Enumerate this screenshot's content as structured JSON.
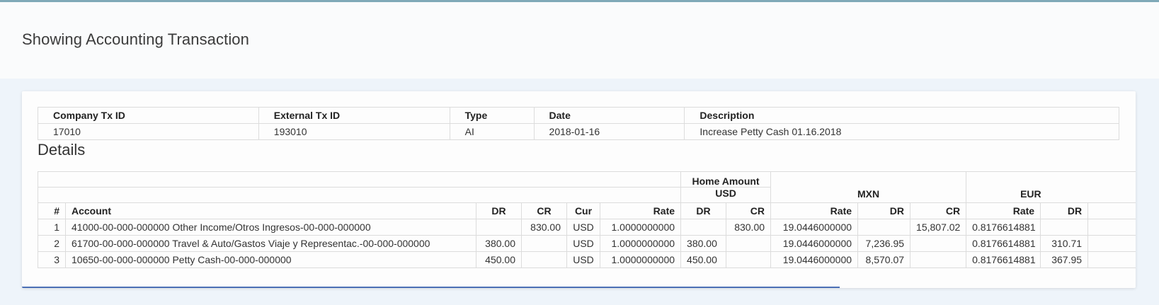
{
  "page": {
    "title": "Showing Accounting Transaction"
  },
  "summary": {
    "headers": [
      "Company Tx ID",
      "External Tx ID",
      "Type",
      "Date",
      "Description"
    ],
    "row": [
      "17010",
      "193010",
      "AI",
      "2018-01-16",
      "Increase Petty Cash 01.16.2018"
    ]
  },
  "details": {
    "heading": "Details",
    "group_headers": {
      "home_amount": "Home Amount",
      "usd": "USD",
      "mxn": "MXN",
      "eur": "EUR"
    },
    "columns": [
      "#",
      "Account",
      "DR",
      "CR",
      "Cur",
      "Rate",
      "DR",
      "CR",
      "Rate",
      "DR",
      "CR",
      "Rate",
      "DR"
    ],
    "rows": [
      [
        "1",
        "41000-00-000-000000 Other Income/Otros Ingresos-00-000-000000",
        "",
        "830.00",
        "USD",
        "1.0000000000",
        "",
        "830.00",
        "19.0446000000",
        "",
        "15,807.02",
        "0.8176614881",
        ""
      ],
      [
        "2",
        "61700-00-000-000000 Travel & Auto/Gastos Viaje y Representac.-00-000-000000",
        "380.00",
        "",
        "USD",
        "1.0000000000",
        "380.00",
        "",
        "19.0446000000",
        "7,236.95",
        "",
        "0.8176614881",
        "310.71"
      ],
      [
        "3",
        "10650-00-000-000000 Petty Cash-00-000-000000",
        "450.00",
        "",
        "USD",
        "1.0000000000",
        "450.00",
        "",
        "19.0446000000",
        "8,570.07",
        "",
        "0.8176614881",
        "367.95"
      ]
    ]
  },
  "colors": {
    "accent_top": "#7fa9b8",
    "accent_bottom": "#4b6fb5",
    "background": "#eef4fa"
  }
}
